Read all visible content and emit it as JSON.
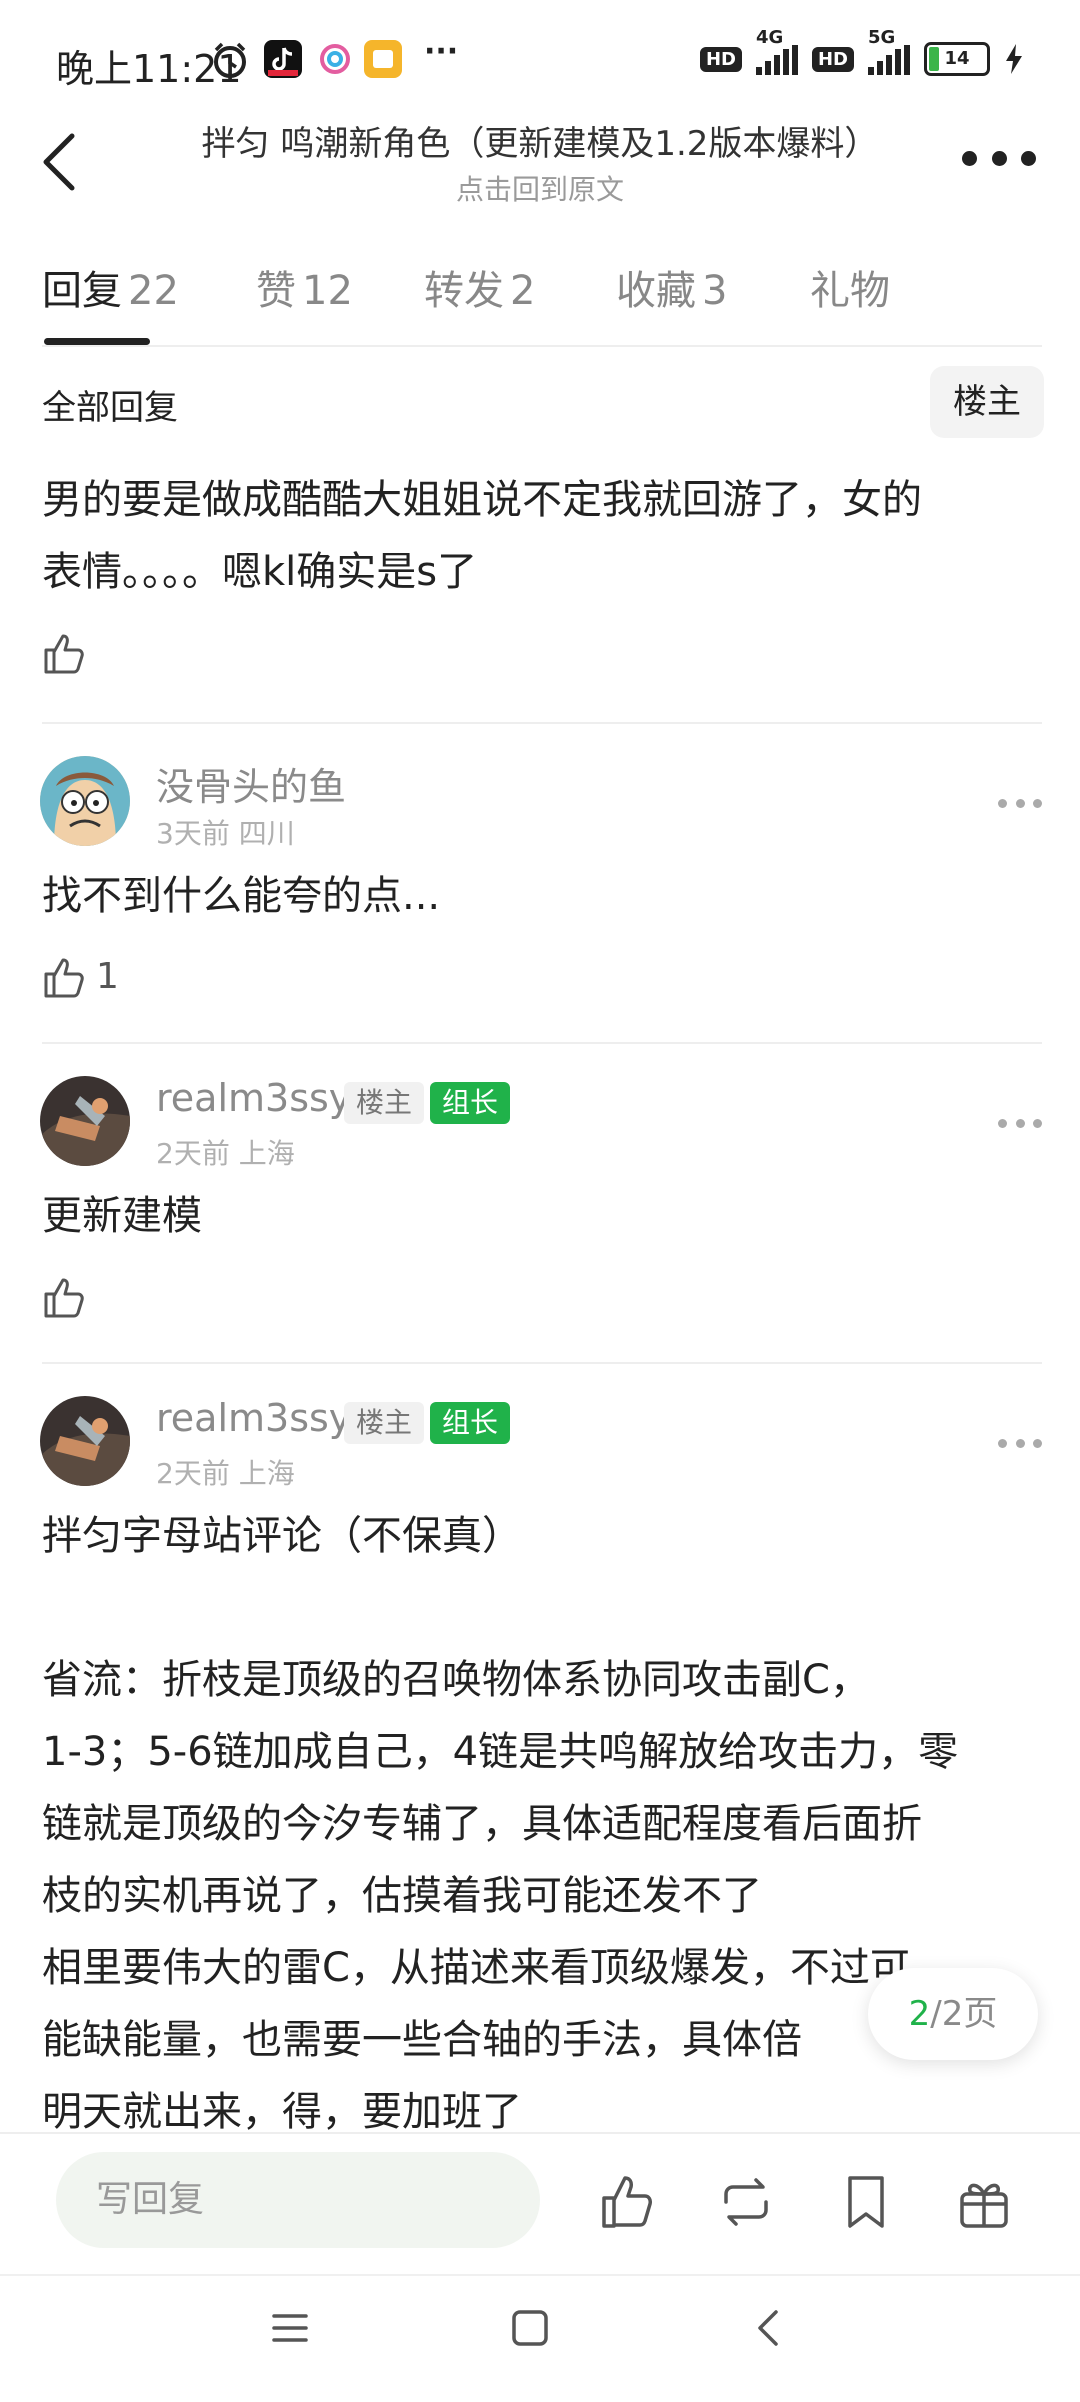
{
  "status": {
    "time": "晚上11:21",
    "net1": "4G",
    "net2": "5G",
    "hd": "HD",
    "battery": "14",
    "more": "···"
  },
  "header": {
    "title": "拌匀 鸣潮新角色（更新建模及1.2版本爆料）",
    "subtitle": "点击回到原文"
  },
  "tabs": [
    {
      "label": "回复",
      "count": "22"
    },
    {
      "label": "赞",
      "count": "12"
    },
    {
      "label": "转发",
      "count": "2"
    },
    {
      "label": "收藏",
      "count": "3"
    },
    {
      "label": "礼物",
      "count": ""
    }
  ],
  "section": {
    "all_replies": "全部回复",
    "op_only": "楼主"
  },
  "first_reply": {
    "line1": "男的要是做成酷酷大姐姐说不定我就回游了，女的",
    "line2": "表情。。。。嗯kl确实是s了"
  },
  "replies": [
    {
      "user": "没骨头的鱼",
      "meta": "3天前 四川",
      "text": "找不到什么能夸的点...",
      "likes": "1"
    },
    {
      "user": "realm3ssy",
      "tag1": "楼主",
      "tag2": "组长",
      "meta": "2天前 上海",
      "text": "更新建模",
      "likes": ""
    },
    {
      "user": "realm3ssy",
      "tag1": "楼主",
      "tag2": "组长",
      "meta": "2天前 上海",
      "lines": [
        "拌匀字母站评论（不保真）",
        "",
        "省流：折枝是顶级的召唤物体系协同攻击副C，",
        "1-3；5-6链加成自己，4链是共鸣解放给攻击力，零",
        "链就是顶级的今汐专辅了，具体适配程度看后面折",
        "枝的实机再说了，估摸着我可能还发不了",
        "相里要伟大的雷C，从描述来看顶级爆发，不过可",
        "能缺能量，也需要一些合轴的手法，具体倍",
        "明天就出来，得，要加班了"
      ]
    }
  ],
  "pagination": {
    "current": "2",
    "total": "/2页"
  },
  "bottom": {
    "reply_placeholder": "写回复"
  },
  "colors": {
    "accent": "#20b24a",
    "text": "#222222",
    "muted": "#8a8a8a"
  }
}
